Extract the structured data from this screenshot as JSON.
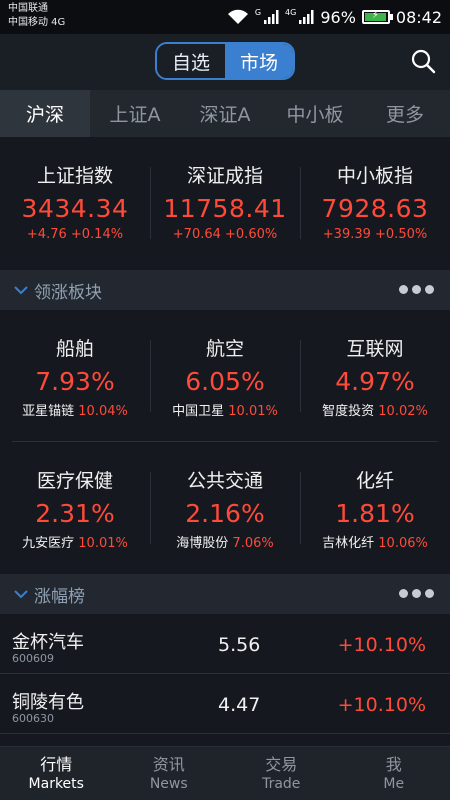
{
  "status_bar": {
    "carrier1": "中国联通",
    "carrier2": "中国移动 4G",
    "net_small_1": "G",
    "net_small_2": "4G",
    "battery": "96%",
    "time": "08:42",
    "battery_level": 0.96
  },
  "header": {
    "seg_watchlist": "自选",
    "seg_market": "市场",
    "active_segment": "市场"
  },
  "tabs": [
    {
      "label": "沪深",
      "active": true
    },
    {
      "label": "上证A",
      "active": false
    },
    {
      "label": "深证A",
      "active": false
    },
    {
      "label": "中小板",
      "active": false
    },
    {
      "label": "更多",
      "active": false
    }
  ],
  "indices": [
    {
      "name": "上证指数",
      "value": "3434.34",
      "change": "+4.76 +0.14%"
    },
    {
      "name": "深证成指",
      "value": "11758.41",
      "change": "+70.64 +0.60%"
    },
    {
      "name": "中小板指",
      "value": "7928.63",
      "change": "+39.39 +0.50%"
    }
  ],
  "sections": {
    "leading_sectors": "领涨板块",
    "gainers": "涨幅榜"
  },
  "sectors": [
    {
      "name": "船舶",
      "pct": "7.93%",
      "leader": "亚星锚链",
      "leader_pct": "10.04%"
    },
    {
      "name": "航空",
      "pct": "6.05%",
      "leader": "中国卫星",
      "leader_pct": "10.01%"
    },
    {
      "name": "互联网",
      "pct": "4.97%",
      "leader": "智度投资",
      "leader_pct": "10.02%"
    },
    {
      "name": "医疗保健",
      "pct": "2.31%",
      "leader": "九安医疗",
      "leader_pct": "10.01%"
    },
    {
      "name": "公共交通",
      "pct": "2.16%",
      "leader": "海博股份",
      "leader_pct": "7.06%"
    },
    {
      "name": "化纤",
      "pct": "1.81%",
      "leader": "吉林化纤",
      "leader_pct": "10.06%"
    }
  ],
  "gainers": [
    {
      "name": "金杯汽车",
      "code": "600609",
      "price": "5.56",
      "change": "+10.10%"
    },
    {
      "name": "铜陵有色",
      "code": "600630",
      "price": "4.47",
      "change": "+10.10%"
    }
  ],
  "bottom_nav": [
    {
      "cn": "行情",
      "en": "Markets",
      "active": true
    },
    {
      "cn": "资讯",
      "en": "News",
      "active": false
    },
    {
      "cn": "交易",
      "en": "Trade",
      "active": false
    },
    {
      "cn": "我",
      "en": "Me",
      "active": false
    }
  ],
  "colors": {
    "up": "#ff4a3a",
    "accent": "#3a7fd0",
    "background": "#15191f"
  }
}
